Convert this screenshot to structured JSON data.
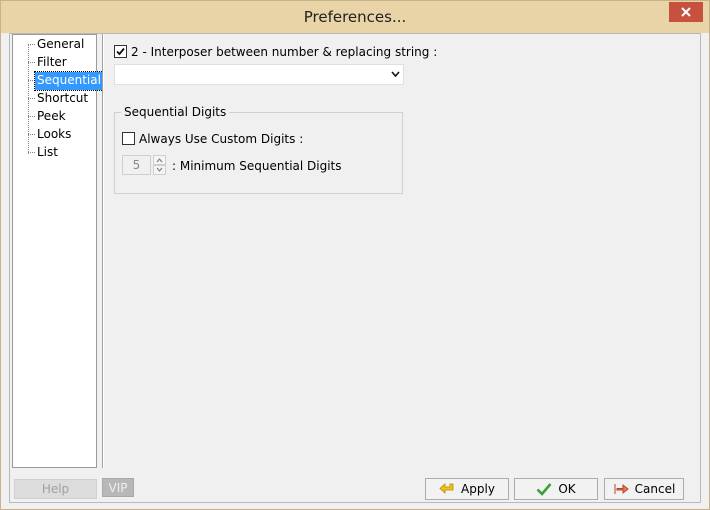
{
  "window": {
    "title": "Preferences..."
  },
  "tree": {
    "items": [
      {
        "label": "General"
      },
      {
        "label": "Filter"
      },
      {
        "label": "Sequential",
        "selected": true
      },
      {
        "label": "Shortcut"
      },
      {
        "label": "Peek"
      },
      {
        "label": "Looks"
      },
      {
        "label": "List"
      }
    ]
  },
  "sequential": {
    "interposer_checkbox": {
      "checked": true,
      "label": "2 - Interposer between number & replacing string :"
    },
    "interposer_combo": {
      "value": ""
    },
    "group": {
      "title": "Sequential Digits",
      "always_custom": {
        "checked": false,
        "label": "Always Use Custom Digits :"
      },
      "min_digits": {
        "value": "5",
        "label": ": Minimum Sequential Digits"
      }
    }
  },
  "buttons": {
    "help": "Help",
    "vip": "VIP",
    "apply": "Apply",
    "ok": "OK",
    "cancel": "Cancel"
  },
  "colors": {
    "titlebar": "#e9d4a8",
    "close": "#c7503f",
    "selection": "#3399ff"
  }
}
